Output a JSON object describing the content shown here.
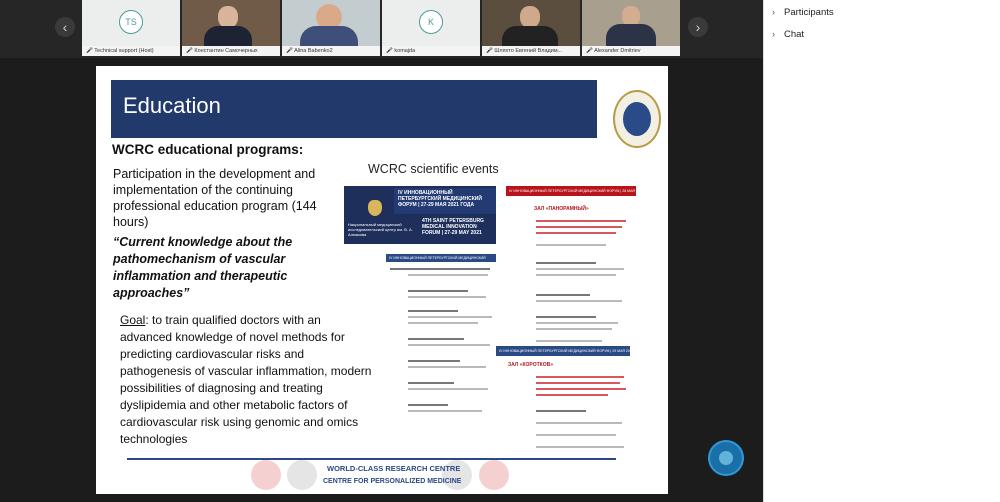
{
  "participants_strip": {
    "tiles": [
      {
        "label": "Technical support",
        "suffix": "(Host)",
        "initials": "TS"
      },
      {
        "label": "Константин Самочерных",
        "suffix": ""
      },
      {
        "label": "Alina Babenko2",
        "suffix": ""
      },
      {
        "label": "komajda",
        "suffix": "",
        "initials": "K"
      },
      {
        "label": "Шляхто Евгений Владим...",
        "suffix": ""
      },
      {
        "label": "Alexander Dmitriev",
        "suffix": ""
      }
    ],
    "prev_icon": "‹",
    "next_icon": "›"
  },
  "slide": {
    "title": "Education",
    "heading": "WCRC educational programs:",
    "para1": "Participation in the development and implementation of the continuing professional education program (144 hours)",
    "para1_bold": "“Current knowledge about the pathomechanism of vascular inflammation and therapeutic approaches”",
    "goal_label": "Goal",
    "goal_text": ": to train qualified doctors with an advanced knowledge of novel methods for predicting cardiovascular risks and pathogenesis of vascular inflammation, modern possibilities of diagnosing and treating dyslipidemia and other metabolic factors of cardiovascular risk using genomic and omics technologies",
    "scientific_events": "WCRC scientific events",
    "poster_forum_ru": "IV ИННОВАЦИОННЫЙ ПЕТЕРБУРГСКИЙ МЕДИЦИНСКИЙ ФОРУМ | 27-29 МАЯ 2021 ГОДА",
    "poster_forum_en": "4TH SAINT PETERSBURG MEDICAL INNOVATION FORUM | 27-29 MAY 2021",
    "poster_org": "Национальный медицинский исследовательский центр им. В. А. Алмазова",
    "program_left_bar": "IV ИННОВАЦИОННЫЙ ПЕТЕРБУРГСКИЙ МЕДИЦИНСКИЙ ФОРУМ | 27 МАЯ 2021 ГОДА",
    "program_right_bar": "IV ИННОВАЦИОННЫЙ ПЕТЕРБУРГСКИЙ МЕДИЦИНСКИЙ ФОРУМ | 28 МАЯ 2021 ГОДА",
    "program_right_bar2": "IV ИННОВАЦИОННЫЙ ПЕТЕРБУРГСКИЙ МЕДИЦИНСКИЙ ФОРУМ | 29 МАЯ 2021 ГОДА",
    "hall1": "ЗАЛ «ПАНОРАМНЫЙ»",
    "hall2": "ЗАЛ «КОРОТКОВ»",
    "footer_top": "WORLD-CLASS RESEARCH CENTRE",
    "footer_bottom": "CENTRE FOR PERSONALIZED MEDICINE"
  },
  "panel": {
    "participants_label": "Participants",
    "chat_label": "Chat",
    "chevron_icon": "›"
  },
  "colors": {
    "title_bar": "#213a6b",
    "accent_red": "#b8141c",
    "panel_bg": "#ffffff"
  }
}
